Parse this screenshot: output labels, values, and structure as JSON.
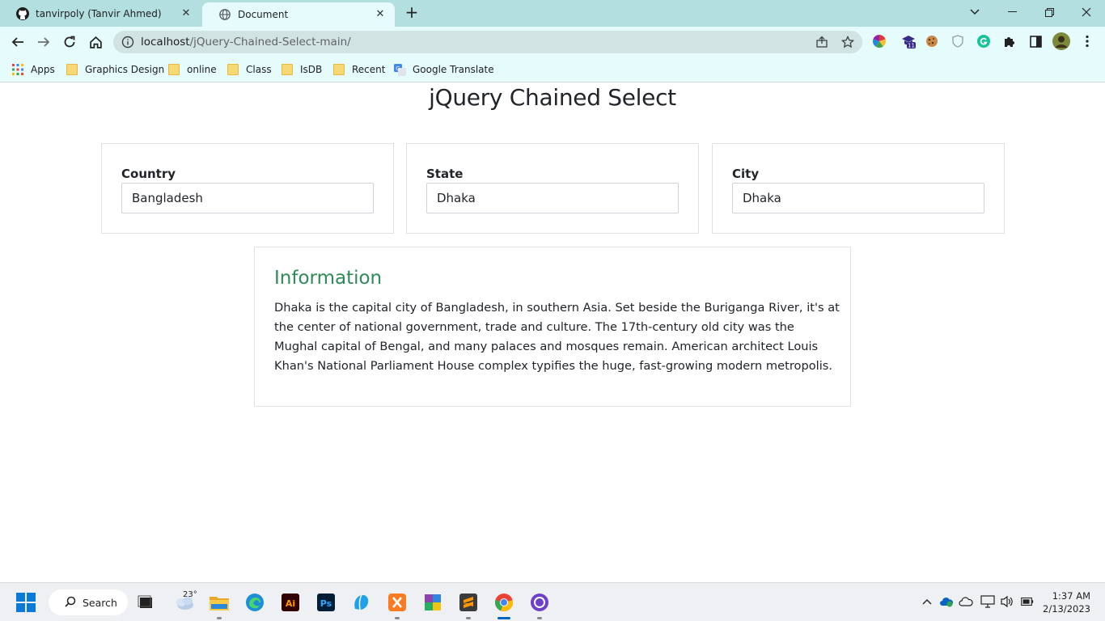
{
  "browser": {
    "tabs": [
      {
        "title": "tanvirpoly (Tanvir Ahmed)",
        "icon": "github-icon",
        "active": false
      },
      {
        "title": "Document",
        "icon": "globe-icon",
        "active": true
      }
    ],
    "url_host": "localhost",
    "url_path": "/jQuery-Chained-Select-main/",
    "bookmarks": [
      {
        "label": "Apps",
        "icon": "apps-grid-icon"
      },
      {
        "label": "Graphics Design",
        "icon": "folder-icon"
      },
      {
        "label": "online",
        "icon": "folder-icon"
      },
      {
        "label": "Class",
        "icon": "folder-icon"
      },
      {
        "label": "IsDB",
        "icon": "folder-icon"
      },
      {
        "label": "Recent",
        "icon": "folder-icon"
      },
      {
        "label": "Google Translate",
        "icon": "google-translate-icon"
      }
    ],
    "extension_badge": "11"
  },
  "page": {
    "title": "jQuery Chained Select",
    "selects": [
      {
        "label": "Country",
        "value": "Bangladesh"
      },
      {
        "label": "State",
        "value": "Dhaka"
      },
      {
        "label": "City",
        "value": "Dhaka"
      }
    ],
    "info": {
      "heading": "Information",
      "text": "Dhaka is the capital city of Bangladesh, in southern Asia. Set beside the Buriganga River, it's at the center of national government, trade and culture. The 17th-century old city was the Mughal capital of Bengal, and many palaces and mosques remain. American architect Louis Khan's National Parliament House complex typifies the huge, fast-growing modern metropolis."
    }
  },
  "taskbar": {
    "search_label": "Search",
    "weather_temp": "23°",
    "time": "1:37 AM",
    "date": "2/13/2023"
  },
  "colors": {
    "tab_strip": "#b3dfe0",
    "toolbar": "#e6fbfb",
    "info_heading": "#2e8b57"
  }
}
